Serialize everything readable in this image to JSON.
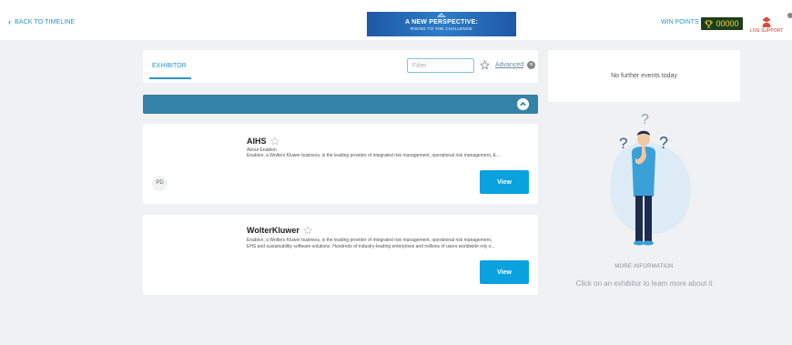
{
  "header": {
    "back_label": "BACK TO TIMELINE",
    "banner_line1": "A NEW PERSPECTIVE:",
    "banner_line2": "RISING TO THE CHALLENGE",
    "win_points_label": "WIN POINTS",
    "points_value": "00000",
    "support_label": "LIVE SUPPORT"
  },
  "tabs": {
    "active": "EXHIBITOR",
    "filter_placeholder": "Filter",
    "advanced_label": "Advanced"
  },
  "exhibitors": [
    {
      "name": "AIHS",
      "subtitle": "About Enablon",
      "description": "Enablon, a Wolters Kluwer business, is the leading provider of integrated risk management, operational risk management, E...",
      "badge": "PD",
      "button": "View"
    },
    {
      "name": "WolterKluwer",
      "description_line1": "Enablon, a Wolters Kluwer business, is the leading provider of integrated risk management, operational risk management,",
      "description_line2": "EHS and sustainability software solutions. Hundreds of industry-leading enterprises and millions of users worldwide rely o...",
      "button": "View"
    }
  ],
  "sidebar": {
    "events_text": "No further events today",
    "more_info": "MORE INFORMATION",
    "hint": "Click on an exhibitor to learn more about it"
  },
  "colors": {
    "accent": "#2a95c8",
    "button": "#0aa1df",
    "bar": "#3582a8",
    "points_bg": "#1e3f1b",
    "points_text": "#f2d43b",
    "support": "#d6362d"
  },
  "icons": [
    "chevron-left-icon",
    "trophy-icon",
    "support-avatar-icon",
    "star-outline-icon",
    "close-circle-icon",
    "chevron-up-icon"
  ]
}
